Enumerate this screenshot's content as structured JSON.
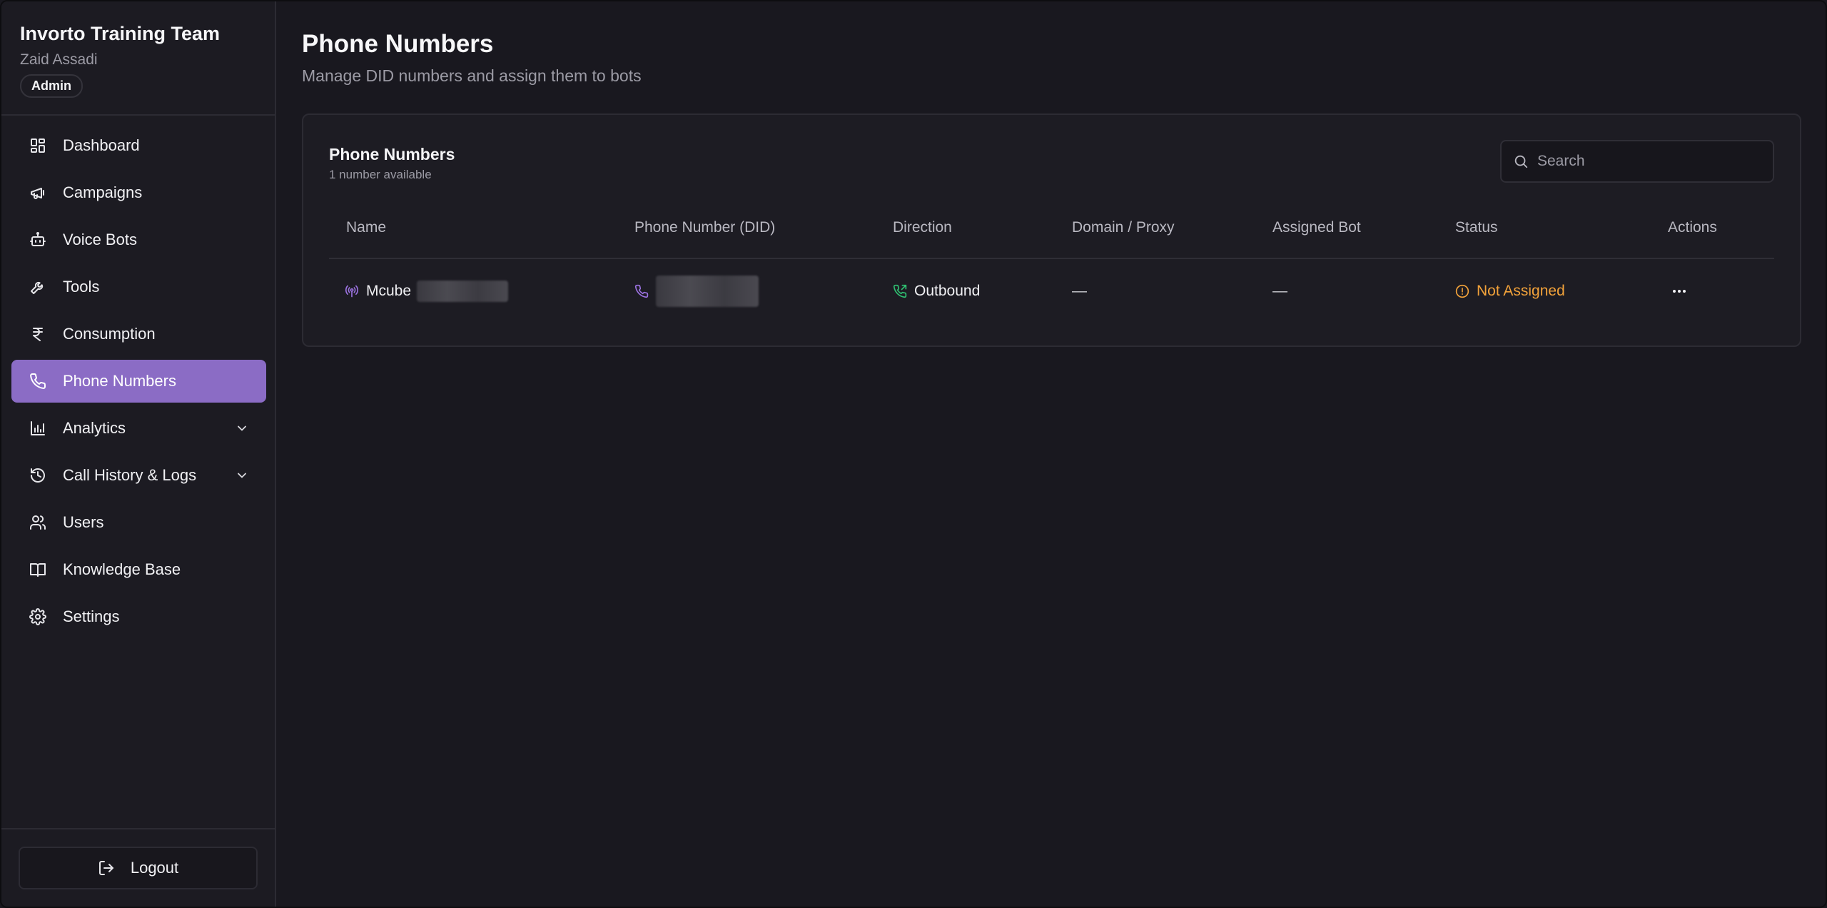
{
  "team": {
    "name": "Invorto Training Team",
    "user": "Zaid Assadi",
    "role": "Admin"
  },
  "nav": [
    {
      "label": "Dashboard",
      "icon": "dashboard-icon"
    },
    {
      "label": "Campaigns",
      "icon": "megaphone-icon"
    },
    {
      "label": "Voice Bots",
      "icon": "bot-icon"
    },
    {
      "label": "Tools",
      "icon": "wrench-icon"
    },
    {
      "label": "Consumption",
      "icon": "rupee-icon"
    },
    {
      "label": "Phone Numbers",
      "icon": "phone-icon",
      "active": true
    },
    {
      "label": "Analytics",
      "icon": "bar-chart-icon",
      "expandable": true
    },
    {
      "label": "Call History & Logs",
      "icon": "history-icon",
      "expandable": true
    },
    {
      "label": "Users",
      "icon": "users-icon"
    },
    {
      "label": "Knowledge Base",
      "icon": "book-icon"
    },
    {
      "label": "Settings",
      "icon": "gear-icon"
    }
  ],
  "logout_label": "Logout",
  "page": {
    "title": "Phone Numbers",
    "subtitle": "Manage DID numbers and assign them to bots"
  },
  "card": {
    "title": "Phone Numbers",
    "subtitle": "1 number available",
    "search_placeholder": "Search"
  },
  "table": {
    "columns": [
      "Name",
      "Phone Number (DID)",
      "Direction",
      "Domain / Proxy",
      "Assigned Bot",
      "Status",
      "Actions"
    ],
    "rows": [
      {
        "name": "Mcube",
        "phone": "",
        "direction": "Outbound",
        "domain": "—",
        "assigned_bot": "—",
        "status": "Not Assigned"
      }
    ]
  },
  "colors": {
    "accent": "#8b6cc5",
    "status_warning": "#f2a23a",
    "outbound": "#2fbf71",
    "name_icon": "#9b72e0"
  }
}
